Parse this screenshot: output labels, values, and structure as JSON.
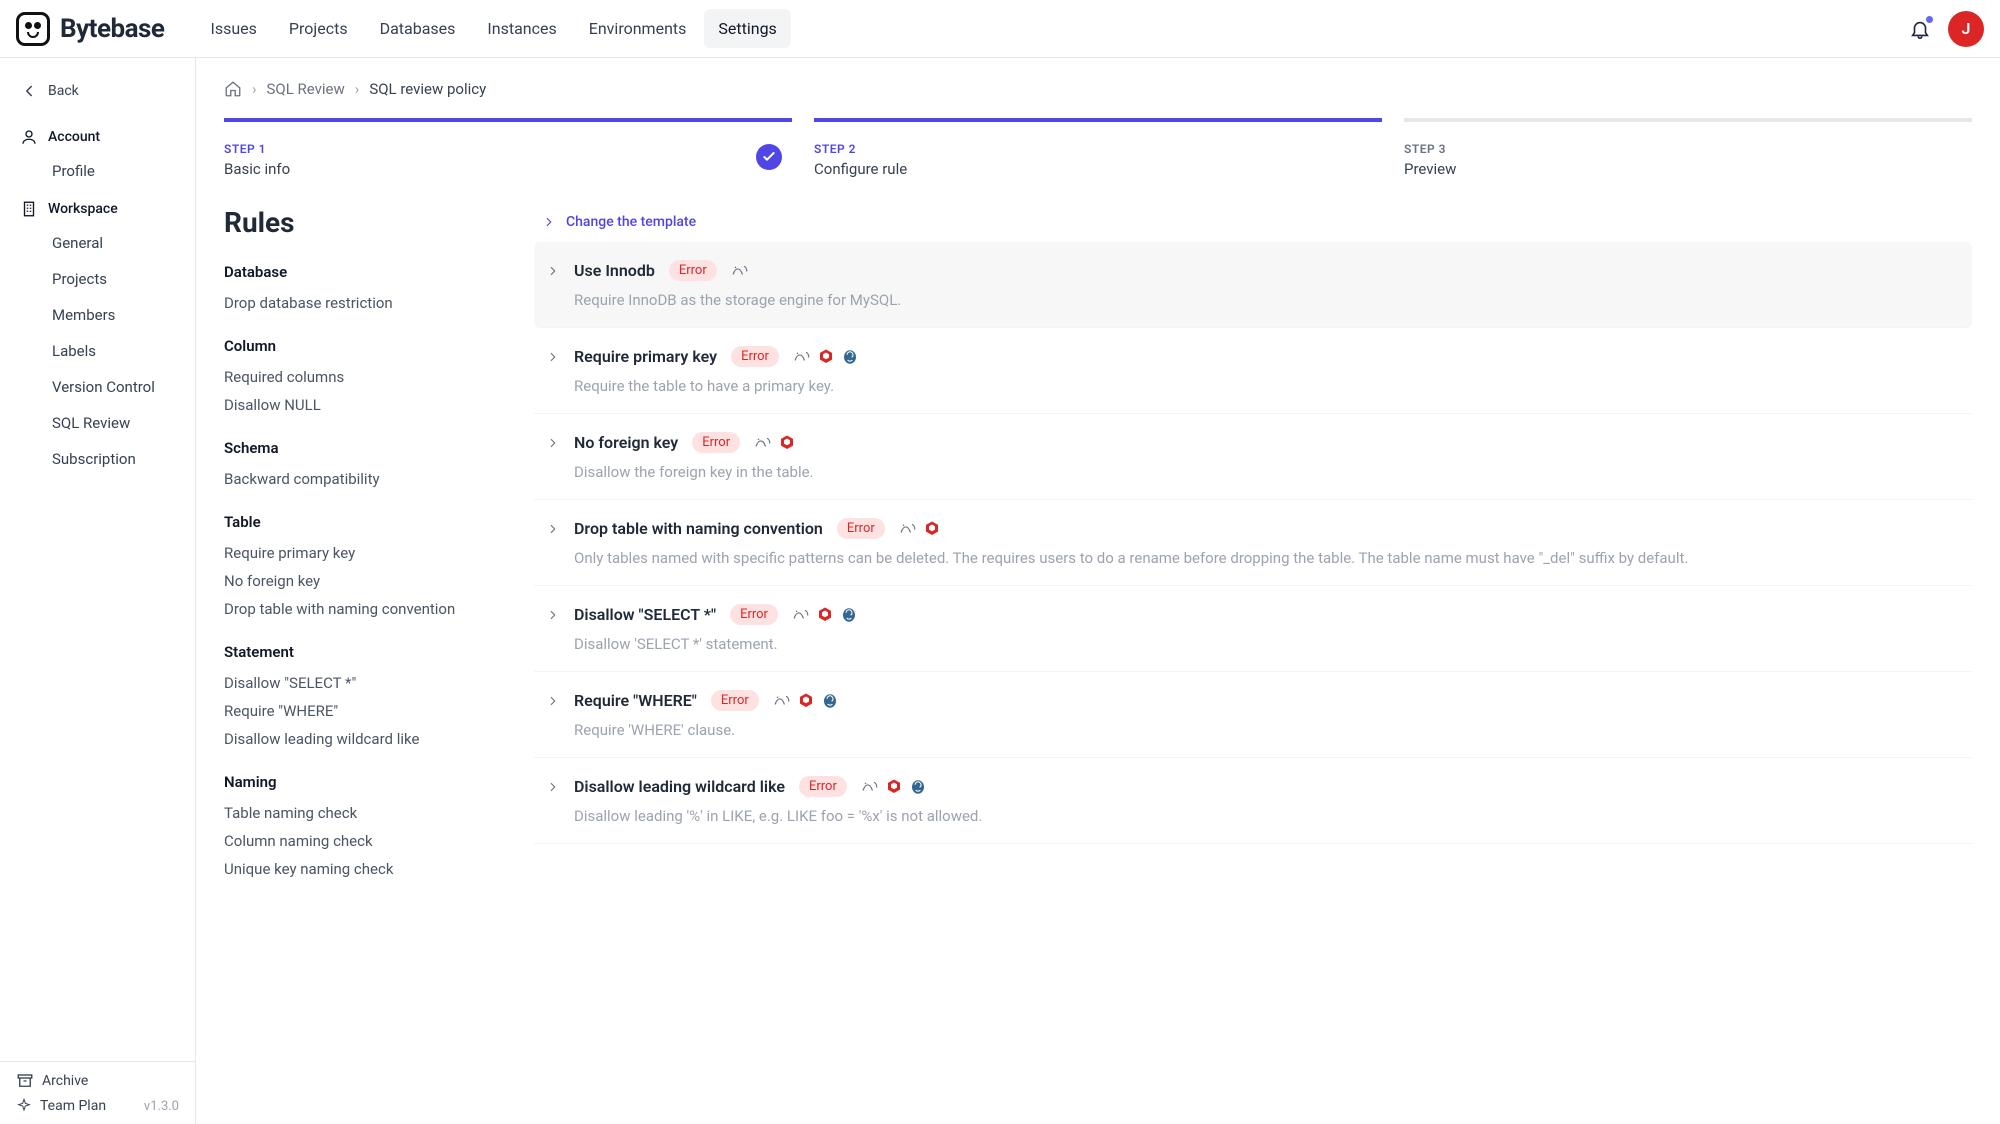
{
  "brand": "Bytebase",
  "nav": {
    "items": [
      {
        "label": "Issues"
      },
      {
        "label": "Projects"
      },
      {
        "label": "Databases"
      },
      {
        "label": "Instances"
      },
      {
        "label": "Environments"
      },
      {
        "label": "Settings",
        "active": true
      }
    ]
  },
  "avatar_initial": "J",
  "sidebar": {
    "back": "Back",
    "sections": [
      {
        "title": "Account",
        "items": [
          {
            "label": "Profile"
          }
        ]
      },
      {
        "title": "Workspace",
        "items": [
          {
            "label": "General"
          },
          {
            "label": "Projects"
          },
          {
            "label": "Members"
          },
          {
            "label": "Labels"
          },
          {
            "label": "Version Control"
          },
          {
            "label": "SQL Review"
          },
          {
            "label": "Subscription"
          }
        ]
      }
    ],
    "footer": {
      "archive": "Archive",
      "plan": "Team Plan",
      "version": "v1.3.0"
    }
  },
  "breadcrumb": [
    {
      "label": "SQL Review"
    },
    {
      "label": "SQL review policy"
    }
  ],
  "steps": [
    {
      "label": "STEP 1",
      "title": "Basic info",
      "state": "done"
    },
    {
      "label": "STEP 2",
      "title": "Configure rule",
      "state": "current"
    },
    {
      "label": "STEP 3",
      "title": "Preview",
      "state": "todo"
    }
  ],
  "rules_heading": "Rules",
  "change_template": "Change the template",
  "rule_groups": [
    {
      "title": "Database",
      "items": [
        {
          "label": "Drop database restriction"
        }
      ]
    },
    {
      "title": "Column",
      "items": [
        {
          "label": "Required columns"
        },
        {
          "label": "Disallow NULL"
        }
      ]
    },
    {
      "title": "Schema",
      "items": [
        {
          "label": "Backward compatibility"
        }
      ]
    },
    {
      "title": "Table",
      "items": [
        {
          "label": "Require primary key"
        },
        {
          "label": "No foreign key"
        },
        {
          "label": "Drop table with naming convention"
        }
      ]
    },
    {
      "title": "Statement",
      "items": [
        {
          "label": "Disallow \"SELECT *\""
        },
        {
          "label": "Require \"WHERE\""
        },
        {
          "label": "Disallow leading wildcard like"
        }
      ]
    },
    {
      "title": "Naming",
      "items": [
        {
          "label": "Table naming check"
        },
        {
          "label": "Column naming check"
        },
        {
          "label": "Unique key naming check"
        }
      ]
    }
  ],
  "rules": [
    {
      "name": "Use Innodb",
      "level": "Error",
      "desc": "Require InnoDB as the storage engine for MySQL.",
      "dbs": [
        "mysql"
      ],
      "active": true
    },
    {
      "name": "Require primary key",
      "level": "Error",
      "desc": "Require the table to have a primary key.",
      "dbs": [
        "mysql",
        "tidb",
        "postgres"
      ]
    },
    {
      "name": "No foreign key",
      "level": "Error",
      "desc": "Disallow the foreign key in the table.",
      "dbs": [
        "mysql",
        "tidb"
      ]
    },
    {
      "name": "Drop table with naming convention",
      "level": "Error",
      "desc": "Only tables named with specific patterns can be deleted. The requires users to do a rename before dropping the table. The table name must have \"_del\" suffix by default.",
      "dbs": [
        "mysql",
        "tidb"
      ]
    },
    {
      "name": "Disallow \"SELECT *\"",
      "level": "Error",
      "desc": "Disallow 'SELECT *' statement.",
      "dbs": [
        "mysql",
        "tidb",
        "postgres"
      ]
    },
    {
      "name": "Require \"WHERE\"",
      "level": "Error",
      "desc": "Require 'WHERE' clause.",
      "dbs": [
        "mysql",
        "tidb",
        "postgres"
      ]
    },
    {
      "name": "Disallow leading wildcard like",
      "level": "Error",
      "desc": "Disallow leading '%' in LIKE, e.g. LIKE foo = '%x' is not allowed.",
      "dbs": [
        "mysql",
        "tidb",
        "postgres"
      ]
    }
  ]
}
